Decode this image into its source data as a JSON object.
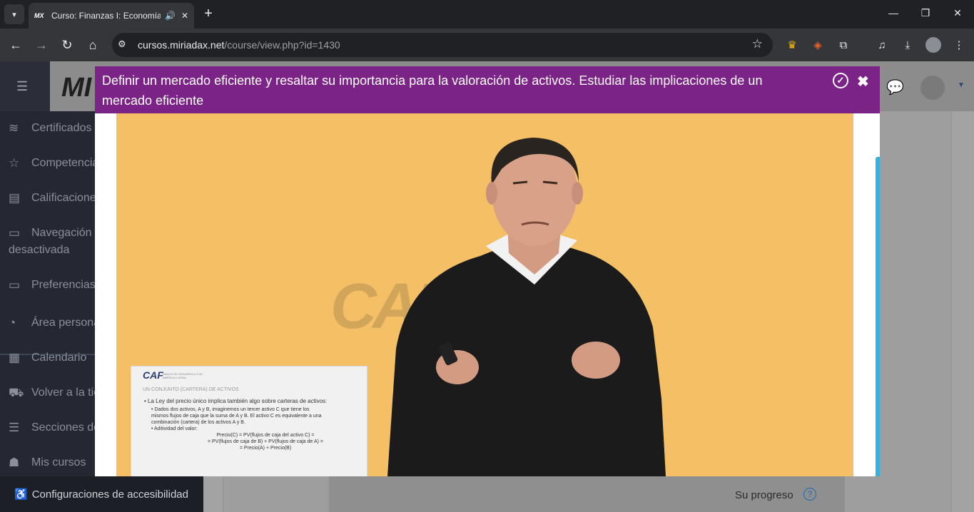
{
  "browser": {
    "tab": {
      "favicon_text": "MX",
      "title": "Curso: Finanzas I: Economía",
      "audio_icon": "speaker-icon",
      "close_label": "✕"
    },
    "new_tab_label": "+",
    "window_controls": {
      "minimize": "—",
      "restore": "❐",
      "close": "✕"
    },
    "nav": {
      "back": "←",
      "forward": "→",
      "reload": "↻",
      "home": "⌂"
    },
    "address": {
      "host": "cursos.miriadax.net",
      "path": "/course/view.php?id=1430"
    }
  },
  "site": {
    "logo_text": "MI",
    "menu_icon": "hamburger-icon"
  },
  "sidebar": {
    "items": [
      {
        "icon": "layers-icon",
        "glyph": "≋",
        "label": "Certificados"
      },
      {
        "icon": "star-icon",
        "glyph": "☆",
        "label": "Competencias"
      },
      {
        "icon": "book-icon",
        "glyph": "▤",
        "label": "Calificaciones"
      },
      {
        "icon": "folder-icon",
        "glyph": "▭",
        "label": "Navegación",
        "label2": "desactivada"
      },
      {
        "icon": "folder-icon",
        "glyph": "▭",
        "label": "Preferencias"
      },
      {
        "icon": "dashboard-icon",
        "glyph": "◔",
        "label": "Área personal"
      },
      {
        "icon": "calendar-icon",
        "glyph": "▦",
        "label": "Calendario"
      },
      {
        "icon": "cart-icon",
        "glyph": "⛟",
        "label": "Volver a la tienda"
      },
      {
        "icon": "list-icon",
        "glyph": "☰",
        "label": "Secciones del curso"
      },
      {
        "icon": "graduation-icon",
        "glyph": "☗",
        "label": "Mis cursos"
      }
    ],
    "accessibility": {
      "icon": "accessibility-icon",
      "glyph": "♿",
      "label": "Configuraciones de accesibilidad"
    }
  },
  "page": {
    "progress_label": "Su progreso",
    "progress_help": "?"
  },
  "modal": {
    "title": "Definir un mercado eficiente y resaltar su importancia para la valoración de activos. Estudiar las implicaciones de un mercado eficiente",
    "complete_icon": "check-circle-icon",
    "close_icon": "close-icon",
    "video": {
      "watermark": "CAF",
      "slide": {
        "logo": "CAF",
        "logo_sub": "BANCO DE DESARROLLO DE AMÉRICA LATINA",
        "heading": "Un conjunto (cartera) de activos",
        "bullet1": "• La Ley del precio único implica también algo sobre carteras de activos:",
        "bullet2a": "• Dados dos activos, A y B, imaginemos un tercer activo C que tiene los",
        "bullet2b": "mismos flujos de caja que la suma de A y B. El activo C es equivalente a una",
        "bullet2c": "combinación (cartera) de los activos A y B.",
        "bullet3": "• Aditividad del valor:",
        "eq1": "Precio(C) = PV(flujos de caja del activo C) =",
        "eq2": "= PV(flujos de caja de B) + PV(flujos de caja de A) =",
        "eq3": "= Precio(A) + Precio(B)"
      }
    }
  }
}
